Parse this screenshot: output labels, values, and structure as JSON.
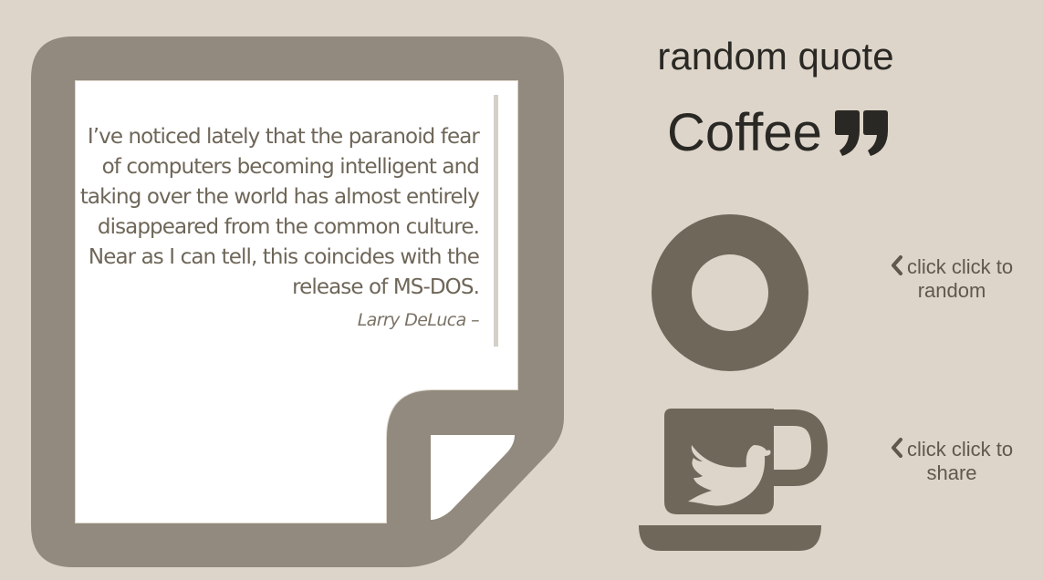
{
  "app": {
    "title": "random quote",
    "brand": "Coffee"
  },
  "quote": {
    "text": "I’ve noticed lately that the paranoid fear of computers becoming intelligent and taking over the world has almost entirely disappeared from the common culture. Near as I can tell, this coincides with the release of MS-DOS.",
    "author": "Larry DeLuca –"
  },
  "actions": {
    "random_hint": "click click to random",
    "share_hint": "click click to share"
  },
  "icons": {
    "paper": "document-page-icon",
    "brand": "quote-mark-icon",
    "random": "ring-icon",
    "share": "coffee-cup-twitter-icon",
    "hint": "chevron-left-icon"
  },
  "colors": {
    "background": "#ddd5c9",
    "paper": "#928a7e",
    "icon": "#6f675a",
    "text": "#2a2824"
  }
}
